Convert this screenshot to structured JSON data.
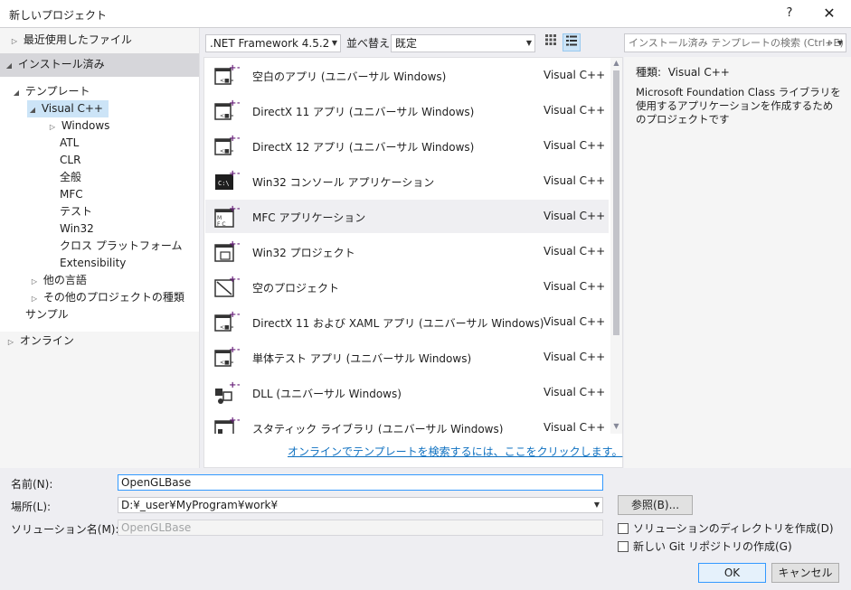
{
  "window": {
    "title": "新しいプロジェクト",
    "help_label": "?",
    "close_label": "✕"
  },
  "tree": {
    "recent": "最近使用したファイル",
    "installed": "インストール済み",
    "templates": "テンプレート",
    "visual_cpp": "Visual C++",
    "children": [
      "Windows",
      "ATL",
      "CLR",
      "全般",
      "MFC",
      "テスト",
      "Win32",
      "クロス プラットフォーム",
      "Extensibility"
    ],
    "other_languages": "他の言語",
    "other_project_types": "その他のプロジェクトの種類",
    "samples": "サンプル",
    "online": "オンライン"
  },
  "toolbar": {
    "framework": ".NET Framework 4.5.2",
    "sort_label": "並べ替え:",
    "sort_value": "既定",
    "search_placeholder": "インストール済み テンプレートの検索 (Ctrl+E)"
  },
  "templates": [
    {
      "name": "空白のアプリ (ユニバーサル Windows)",
      "lang": "Visual C++",
      "icon": "uwp-app-icon"
    },
    {
      "name": "DirectX 11 アプリ (ユニバーサル Windows)",
      "lang": "Visual C++",
      "icon": "uwp-app-icon"
    },
    {
      "name": "DirectX 12 アプリ (ユニバーサル Windows)",
      "lang": "Visual C++",
      "icon": "uwp-app-icon"
    },
    {
      "name": "Win32 コンソール アプリケーション",
      "lang": "Visual C++",
      "icon": "console-app-icon"
    },
    {
      "name": "MFC アプリケーション",
      "lang": "Visual C++",
      "icon": "mfc-app-icon"
    },
    {
      "name": "Win32 プロジェクト",
      "lang": "Visual C++",
      "icon": "win32-project-icon"
    },
    {
      "name": "空のプロジェクト",
      "lang": "Visual C++",
      "icon": "empty-project-icon"
    },
    {
      "name": "DirectX 11 および XAML アプリ (ユニバーサル Windows)",
      "lang": "Visual C++",
      "icon": "uwp-app-icon"
    },
    {
      "name": "単体テスト アプリ (ユニバーサル Windows)",
      "lang": "Visual C++",
      "icon": "uwp-app-icon"
    },
    {
      "name": "DLL (ユニバーサル Windows)",
      "lang": "Visual C++",
      "icon": "dll-icon"
    },
    {
      "name": "スタティック ライブラリ (ユニバーサル Windows)",
      "lang": "Visual C++",
      "icon": "static-lib-icon"
    }
  ],
  "online_link": "オンラインでテンプレートを検索するには、ここをクリックします。",
  "info": {
    "kind_label": "種類:",
    "kind_value": "Visual C++",
    "description": "Microsoft Foundation Class ライブラリを使用するアプリケーションを作成するためのプロジェクトです"
  },
  "form": {
    "name_label": "名前(N):",
    "name_value": "OpenGLBase",
    "location_label": "場所(L):",
    "location_value": "D:¥_user¥MyProgram¥work¥",
    "solution_label": "ソリューション名(M):",
    "solution_value": "OpenGLBase",
    "browse_label": "参照(B)...",
    "create_dir_label": "ソリューションのディレクトリを作成(D)",
    "git_label": "新しい Git リポジトリの作成(G)",
    "ok_label": "OK",
    "cancel_label": "キャンセル"
  },
  "colors": {
    "accent": "#68217a",
    "selection": "#cce4f7",
    "link": "#0e70c0"
  }
}
